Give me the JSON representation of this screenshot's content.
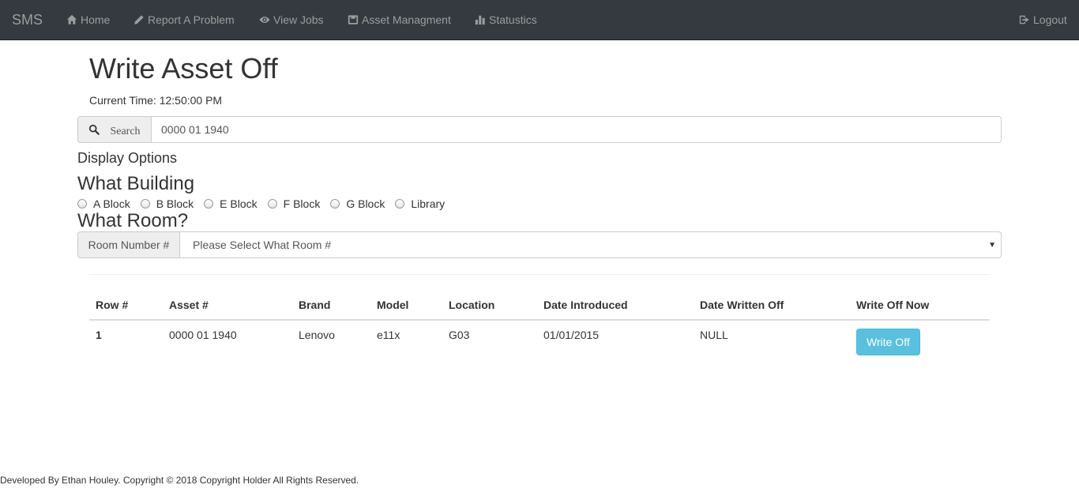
{
  "navbar": {
    "brand": "SMS",
    "items": [
      {
        "label": "Home",
        "icon": "home-icon"
      },
      {
        "label": "Report A Problem",
        "icon": "pencil-icon"
      },
      {
        "label": "View Jobs",
        "icon": "eye-icon"
      },
      {
        "label": "Asset Managment",
        "icon": "inbox-icon"
      },
      {
        "label": "Statustics",
        "icon": "bar-chart-icon"
      }
    ],
    "logout": {
      "label": "Logout",
      "icon": "logout-icon"
    },
    "bg_color": "#343a40",
    "text_color": "#9d9d9d"
  },
  "page": {
    "title": "Write Asset Off",
    "current_time": "Current Time: 12:50:00 PM"
  },
  "search": {
    "icon": "search-icon",
    "label": "Search",
    "value": "0000 01 1940"
  },
  "display_options": {
    "label": "Display Options",
    "building_heading": "What Building",
    "buildings": [
      "A Block",
      "B Block",
      "E Block",
      "F Block",
      "G Block",
      "Library"
    ],
    "room_heading": "What Room?",
    "room_addon": "Room Number #",
    "room_selected": "Please Select What Room #"
  },
  "table": {
    "headers": [
      "Row #",
      "Asset #",
      "Brand",
      "Model",
      "Location",
      "Date Introduced",
      "Date Written Off",
      "Write Off Now"
    ],
    "rows": [
      {
        "row": "1",
        "asset": "0000 01 1940",
        "brand": "Lenovo",
        "model": "e11x",
        "location": "G03",
        "introduced": "01/01/2015",
        "written_off": "NULL",
        "action": "Write Off"
      }
    ],
    "button_color": "#5bc0de"
  },
  "footer": {
    "text": "Developed By Ethan Houley. Copyright © 2018 Copyright Holder All Rights Reserved."
  }
}
